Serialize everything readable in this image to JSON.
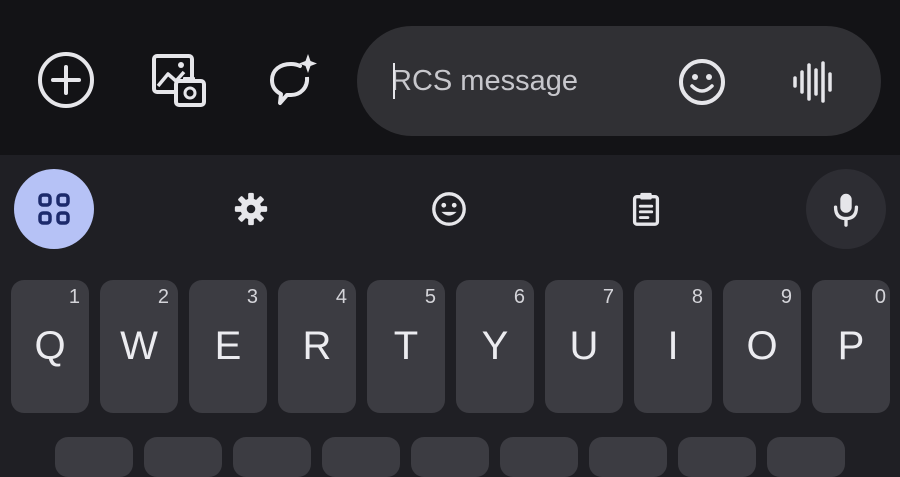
{
  "compose": {
    "add_icon": "add-circle-icon",
    "gallery_icon": "gallery-camera-icon",
    "magic_icon": "sparkle-chat-icon",
    "placeholder": "RCS message",
    "emoji_icon": "emoji-icon",
    "voice_icon": "voice-waveform-icon"
  },
  "toolbar": {
    "items": [
      "apps-grid-icon",
      "settings-gear-icon",
      "emoji-icon",
      "clipboard-icon",
      "microphone-icon"
    ],
    "apps_accent": "#b6c2f6"
  },
  "keyboard": {
    "row1": [
      {
        "letter": "Q",
        "num": "1"
      },
      {
        "letter": "W",
        "num": "2"
      },
      {
        "letter": "E",
        "num": "3"
      },
      {
        "letter": "R",
        "num": "4"
      },
      {
        "letter": "T",
        "num": "5"
      },
      {
        "letter": "Y",
        "num": "6"
      },
      {
        "letter": "U",
        "num": "7"
      },
      {
        "letter": "I",
        "num": "8"
      },
      {
        "letter": "O",
        "num": "9"
      },
      {
        "letter": "P",
        "num": "0"
      }
    ]
  },
  "colors": {
    "compose_bg": "#131316",
    "pill_bg": "#303034",
    "keyboard_bg": "#1f1f24",
    "key_bg": "#3c3c42"
  }
}
